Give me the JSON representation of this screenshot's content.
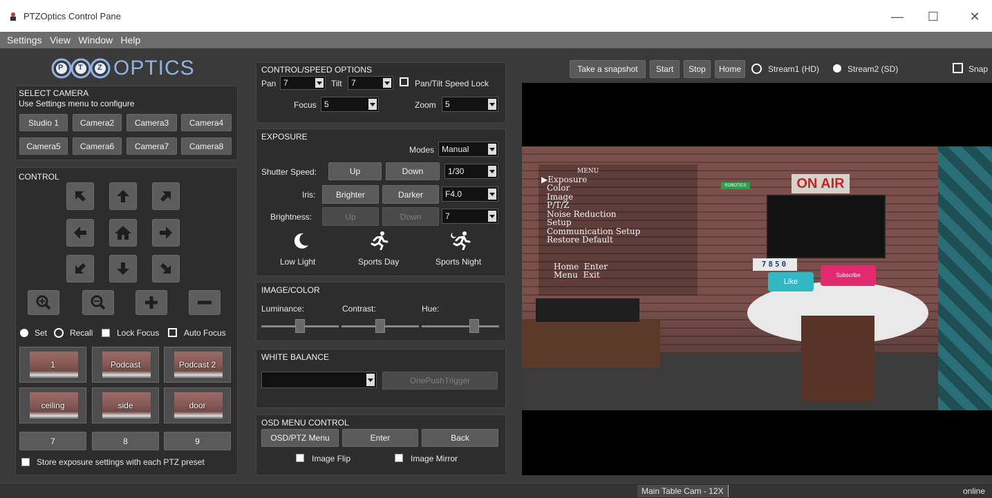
{
  "window": {
    "title": "PTZOptics Control Pane",
    "minimize_icon": "minimize-icon",
    "maximize_icon": "maximize-icon",
    "close_icon": "close-icon"
  },
  "menu": [
    "Settings",
    "View",
    "Window",
    "Help"
  ],
  "logo": {
    "text": "OPTICS",
    "letters": [
      "P",
      "T",
      "Z"
    ]
  },
  "select_camera": {
    "heading": "SELECT CAMERA",
    "hint": "Use Settings menu to configure",
    "cameras": [
      "Studio 1",
      "Camera2",
      "Camera3",
      "Camera4",
      "Camera5",
      "Camera6",
      "Camera7",
      "Camera8"
    ]
  },
  "control": {
    "heading": "CONTROL",
    "set_label": "Set",
    "recall_label": "Recall",
    "lock_focus_label": "Lock Focus",
    "auto_focus_label": "Auto Focus",
    "presets": [
      "1",
      "Podcast",
      "Podcast 2",
      "ceiling",
      "side",
      "door"
    ],
    "numbered": [
      "7",
      "8",
      "9"
    ],
    "store_label": "Store exposure settings with each PTZ preset"
  },
  "speed": {
    "heading": "CONTROL/SPEED OPTIONS",
    "pan_label": "Pan",
    "pan_value": "7",
    "tilt_label": "Tilt",
    "tilt_value": "7",
    "lock_label": "Pan/Tilt Speed Lock",
    "focus_label": "Focus",
    "focus_value": "5",
    "zoom_label": "Zoom",
    "zoom_value": "5"
  },
  "exposure": {
    "heading": "EXPOSURE",
    "modes_label": "Modes",
    "modes_value": "Manual",
    "shutter_label": "Shutter Speed:",
    "shutter_up": "Up",
    "shutter_down": "Down",
    "shutter_value": "1/30",
    "iris_label": "Iris:",
    "iris_brighter": "Brighter",
    "iris_darker": "Darker",
    "iris_value": "F4.0",
    "brightness_label": "Brightness:",
    "brightness_up": "Up",
    "brightness_down": "Down",
    "brightness_value": "7",
    "presets": [
      "Low Light",
      "Sports Day",
      "Sports Night"
    ]
  },
  "image_color": {
    "heading": "IMAGE/COLOR",
    "luminance_label": "Luminance:",
    "contrast_label": "Contrast:",
    "hue_label": "Hue:"
  },
  "white_balance": {
    "heading": "WHITE BALANCE",
    "mode_value": "",
    "onepush_label": "OnePushTrigger"
  },
  "osd": {
    "heading": "OSD MENU CONTROL",
    "menu_label": "OSD/PTZ Menu",
    "enter_label": "Enter",
    "back_label": "Back",
    "flip_label": "Image Flip",
    "mirror_label": "Image Mirror"
  },
  "video_toolbar": {
    "snapshot_label": "Take a snapshot",
    "start_label": "Start",
    "stop_label": "Stop",
    "home_label": "Home",
    "stream1_label": "Stream1 (HD)",
    "stream2_label": "Stream2 (SD)",
    "snap_label": "Snap"
  },
  "video_osd": {
    "menu_title": "MENU",
    "items": [
      "▶Exposure",
      "Color",
      "Image",
      "P/T/Z",
      "Noise Reduction",
      "Setup",
      "Communication Setup",
      "Restore Default"
    ],
    "footer_line1": "Home  Enter",
    "footer_line2": "Menu  Exit",
    "on_air_sign": "ON AIR",
    "like_sign": "Like",
    "subscribe_sign": "Subscribe",
    "robotics_sign": "ROBOTICS",
    "counter_digits": "7850"
  },
  "status": {
    "camera": "Main Table Cam - 12X",
    "connection": "online"
  }
}
